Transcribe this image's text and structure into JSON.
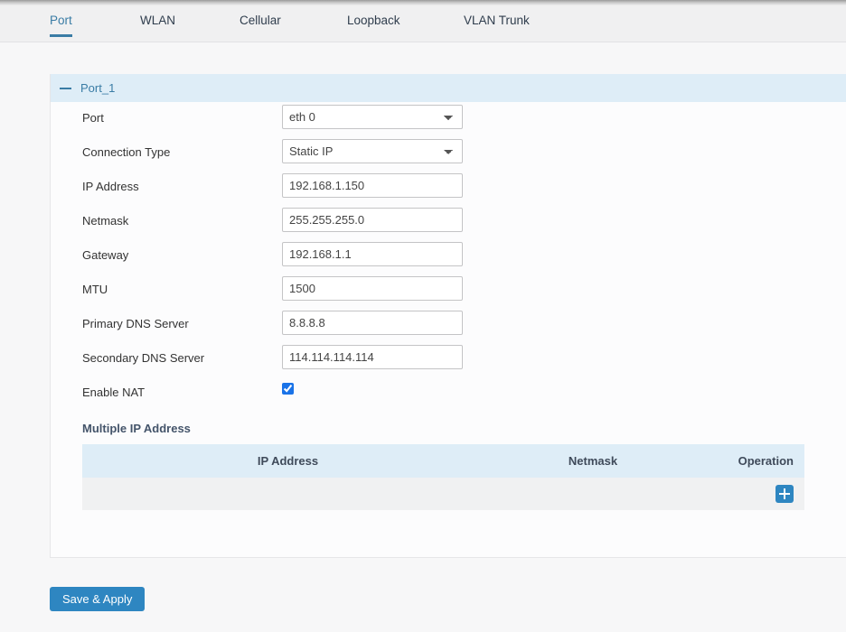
{
  "theme": {
    "accent_blue": "#3a7ca5",
    "button_blue": "#2e86c1",
    "panel_header_bg": "#deedf7",
    "checkbox_blue": "#1a73e8"
  },
  "tabs": [
    {
      "label": "Port",
      "active": true
    },
    {
      "label": "WLAN",
      "active": false
    },
    {
      "label": "Cellular",
      "active": false
    },
    {
      "label": "Loopback",
      "active": false
    },
    {
      "label": "VLAN Trunk",
      "active": false
    }
  ],
  "panel": {
    "title": "Port_1",
    "collapse_icon": "minus-icon"
  },
  "form": {
    "fields": [
      {
        "label": "Port",
        "type": "select",
        "value": "eth 0",
        "options": [
          "eth 0"
        ]
      },
      {
        "label": "Connection Type",
        "type": "select",
        "value": "Static IP",
        "options": [
          "Static IP"
        ]
      },
      {
        "label": "IP Address",
        "type": "text",
        "value": "192.168.1.150",
        "placeholder": ""
      },
      {
        "label": "Netmask",
        "type": "text",
        "value": "255.255.255.0",
        "placeholder": ""
      },
      {
        "label": "Gateway",
        "type": "text",
        "value": "192.168.1.1",
        "placeholder": ""
      },
      {
        "label": "MTU",
        "type": "text",
        "value": "1500",
        "placeholder": ""
      },
      {
        "label": "Primary DNS Server",
        "type": "text",
        "value": "8.8.8.8",
        "placeholder": ""
      },
      {
        "label": "Secondary DNS Server",
        "type": "text",
        "value": "114.114.114.114",
        "placeholder": ""
      },
      {
        "label": "Enable NAT",
        "type": "checkbox",
        "checked": true
      }
    ]
  },
  "multiple_ip": {
    "title": "Multiple IP Address",
    "columns": [
      "IP Address",
      "Netmask",
      "Operation"
    ],
    "rows": [],
    "add_button_icon": "plus-icon"
  },
  "footer": {
    "save_label": "Save & Apply"
  }
}
